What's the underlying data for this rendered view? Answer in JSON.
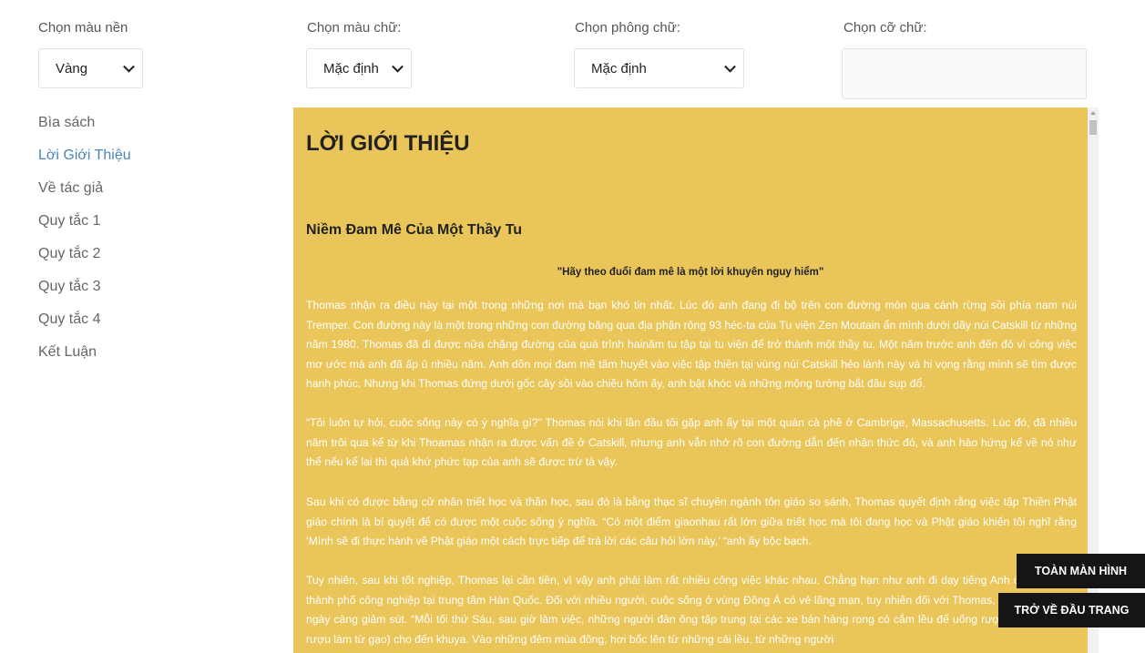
{
  "controls": {
    "bg_color": {
      "label": "Chọn màu nền",
      "value": "Vàng"
    },
    "text_color": {
      "label": "Chọn màu chữ:",
      "value": "Mặc định"
    },
    "font": {
      "label": "Chọn phông chữ:",
      "value": "Mặc định"
    },
    "font_size": {
      "label": "Chọn cỡ chữ:"
    }
  },
  "toc": [
    {
      "label": "Bìa sách",
      "active": false
    },
    {
      "label": "Lời Giới Thiệu",
      "active": true
    },
    {
      "label": "Về tác giả",
      "active": false
    },
    {
      "label": "Quy tắc 1",
      "active": false
    },
    {
      "label": "Quy tắc 2",
      "active": false
    },
    {
      "label": "Quy tắc 3",
      "active": false
    },
    {
      "label": "Quy tắc 4",
      "active": false
    },
    {
      "label": "Kết Luận",
      "active": false
    }
  ],
  "reader": {
    "title": "LỜI GIỚI THIỆU",
    "subtitle": "Niềm Đam Mê Của Một Thầy Tu",
    "quote": "\"Hãy theo đuổi đam mê là một lời khuyên nguy hiểm\"",
    "paragraphs": [
      "Thomas nhận ra điều này tại một trong những nơi mà bạn khó tin nhất. Lúc đó anh đang đi bộ trên con đường mòn qua cánh rừng sồi phía nam núi Tremper. Con đường này là một trong những con đường băng qua địa phận rộng 93 héc-ta của Tu viện Zen Moutain ẩn mình dưới dãy núi Catskill từ những năm 1980. Thomas đã đi được nửa chặng đường của quá trình hainăm tu tập tại tu viện để trở thành một thầy tu. Một năm trước anh đến đó vì công việc mơ ước mà anh đã ấp ủ nhiều năm. Anh dồn mọi đam mê tâm huyết vào việc tập thiền tại vùng núi Catskill hẻo lánh này và hi vọng rằng mình sẽ tìm được hạnh phúc. Nhưng khi Thomas đứng dưới gốc cây sồi vào chiều hôm ấy, anh bật khóc và những mộng tưởng bắt đầu sụp đổ.",
      "“Tôi luôn tự hỏi, cuộc sống này có ý nghĩa gì?” Thomas nói khi lần đầu tôi gặp anh ấy tại một quán cà phê ở Cambrige, Massachusetts. Lúc đó, đã nhiều năm trôi qua kể từ khi Thoamas nhận ra được vấn đề ở Catskill, nhưng anh vẫn nhớ rõ con đường dẫn đến nhận thức đó, và anh hào hứng kể về nó như thể nếu kể lại thì quá khứ phức tạp của anh sẽ được trừ tà vậy.",
      "Sau khi có được bằng cử nhân triết học và thần học, sau đó là bằng thạc sĩ chuyên ngành tôn giáo so sánh, Thomas quyết định rằng việc tập Thiền Phật giáo chính là bí quyết để có được một cuộc sống ý nghĩa. “Có một điểm giaonhau rất lớn giữa triết học mà tôi đang học và Phật giáo khiến tôi nghĩ rằng ‘Mình sẽ đi thực hành về Phật giáo một cách trực tiếp để trả lời các câu hỏi lớn này,’ “anh ấy bộc bạch.",
      "Tuy nhiên, sau khi tốt nghiệp, Thomas lại cần tiền, vì vậy anh phải làm rất nhiều công việc khác nhau. Chẳng hạn như anh đi dạy tiếng Anh ở Gumi, một thành phố công nghiệp tại trung tâm Hàn Quốc. Đối với nhiều người, cuộc sống ở vùng Đông Á có vẻ lãng mạn, tuy nhiên đối với Thomas, sự hấp dẫn này ngày càng giảm sút. “Mỗi tối thứ Sáu, sau giờ làm việc, những người đàn ông tập trung tại các xe bán hàng rong có cắm lều để uống rượu soju (một loại rượu làm từ gạo) cho đến khuya. Vào những đêm mùa đông, hơi bốc lên từ những cái lều, từ những người"
    ]
  },
  "buttons": {
    "fullscreen": "TOÀN MÀN HÌNH",
    "back_to_top": "TRỞ VỀ ĐẦU TRANG"
  }
}
